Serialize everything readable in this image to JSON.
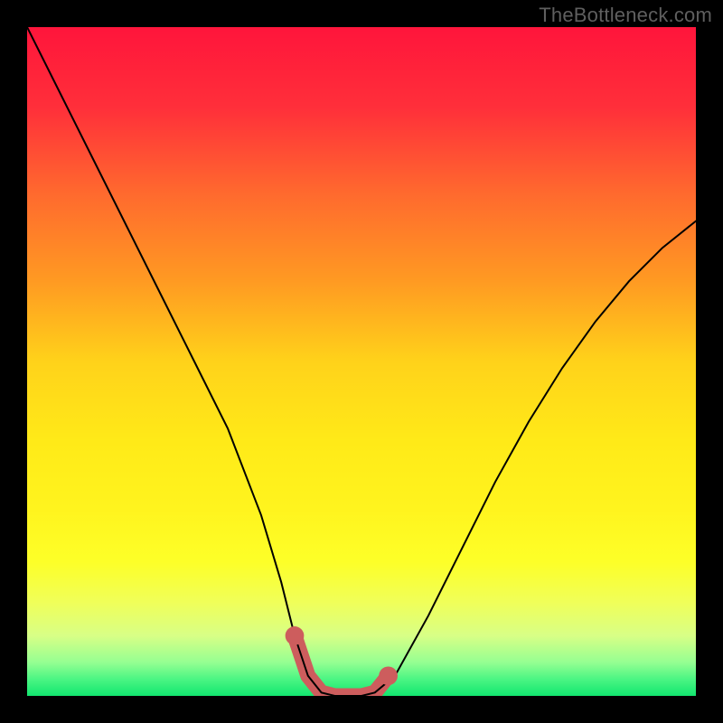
{
  "watermark": "TheBottleneck.com",
  "gradient": {
    "stops": [
      {
        "offset": 0.0,
        "color": "#ff153b"
      },
      {
        "offset": 0.12,
        "color": "#ff2f3a"
      },
      {
        "offset": 0.25,
        "color": "#ff6a2e"
      },
      {
        "offset": 0.38,
        "color": "#ff9a22"
      },
      {
        "offset": 0.5,
        "color": "#ffd21a"
      },
      {
        "offset": 0.62,
        "color": "#ffea18"
      },
      {
        "offset": 0.72,
        "color": "#fff41e"
      },
      {
        "offset": 0.8,
        "color": "#fdff28"
      },
      {
        "offset": 0.86,
        "color": "#f0ff59"
      },
      {
        "offset": 0.91,
        "color": "#d8ff86"
      },
      {
        "offset": 0.95,
        "color": "#95ff92"
      },
      {
        "offset": 0.975,
        "color": "#4bf583"
      },
      {
        "offset": 1.0,
        "color": "#12e66f"
      }
    ]
  },
  "chart_data": {
    "type": "line",
    "title": "",
    "xlabel": "",
    "ylabel": "",
    "xlim": [
      0,
      100
    ],
    "ylim": [
      0,
      100
    ],
    "series": [
      {
        "name": "bottleneck-curve",
        "x": [
          0,
          5,
          10,
          15,
          20,
          25,
          30,
          35,
          38,
          40,
          42,
          44,
          46,
          48,
          50,
          52,
          55,
          60,
          65,
          70,
          75,
          80,
          85,
          90,
          95,
          100
        ],
        "y": [
          100,
          90,
          80,
          70,
          60,
          50,
          40,
          27,
          17,
          9,
          3,
          0.5,
          0,
          0,
          0,
          0.5,
          3,
          12,
          22,
          32,
          41,
          49,
          56,
          62,
          67,
          71
        ]
      }
    ],
    "highlight_band": {
      "name": "optimal-range",
      "x": [
        40,
        42,
        44,
        46,
        48,
        50,
        52,
        54
      ],
      "y": [
        9,
        3,
        0.5,
        0,
        0,
        0,
        0.5,
        3
      ]
    }
  }
}
